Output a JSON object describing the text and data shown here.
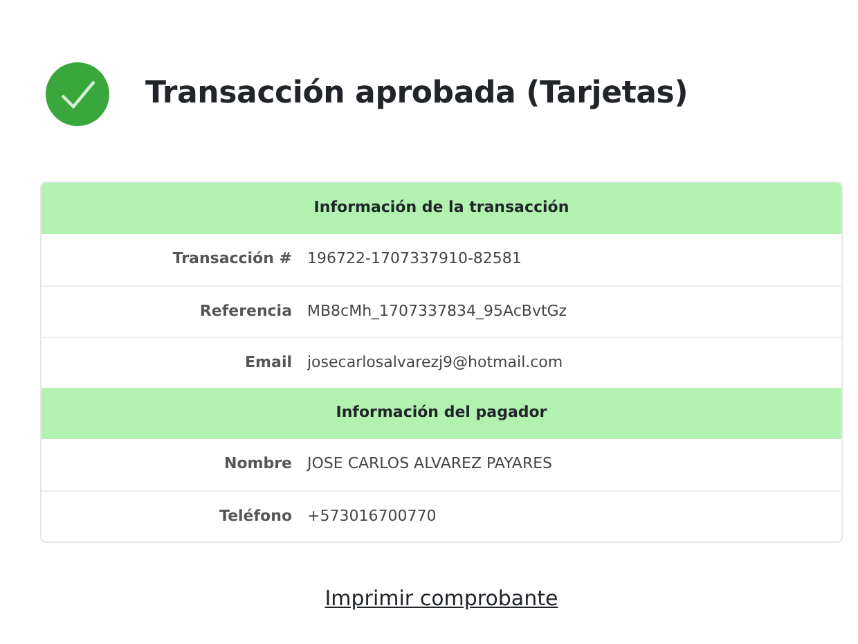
{
  "title": "Transacción aprobada (Tarjetas)",
  "sections": [
    {
      "heading": "Información de la transacción",
      "rows": [
        {
          "label": "Transacción #",
          "value": "196722-1707337910-82581"
        },
        {
          "label": "Referencia",
          "value": "MB8cMh_1707337834_95AcBvtGz"
        },
        {
          "label": "Email",
          "value": "josecarlosalvarezj9@hotmail.com"
        }
      ]
    },
    {
      "heading": "Información del pagador",
      "rows": [
        {
          "label": "Nombre",
          "value": "JOSE CARLOS ALVAREZ PAYARES"
        },
        {
          "label": "Teléfono",
          "value": "+573016700770"
        }
      ]
    }
  ],
  "print_link": "Imprimir comprobante"
}
